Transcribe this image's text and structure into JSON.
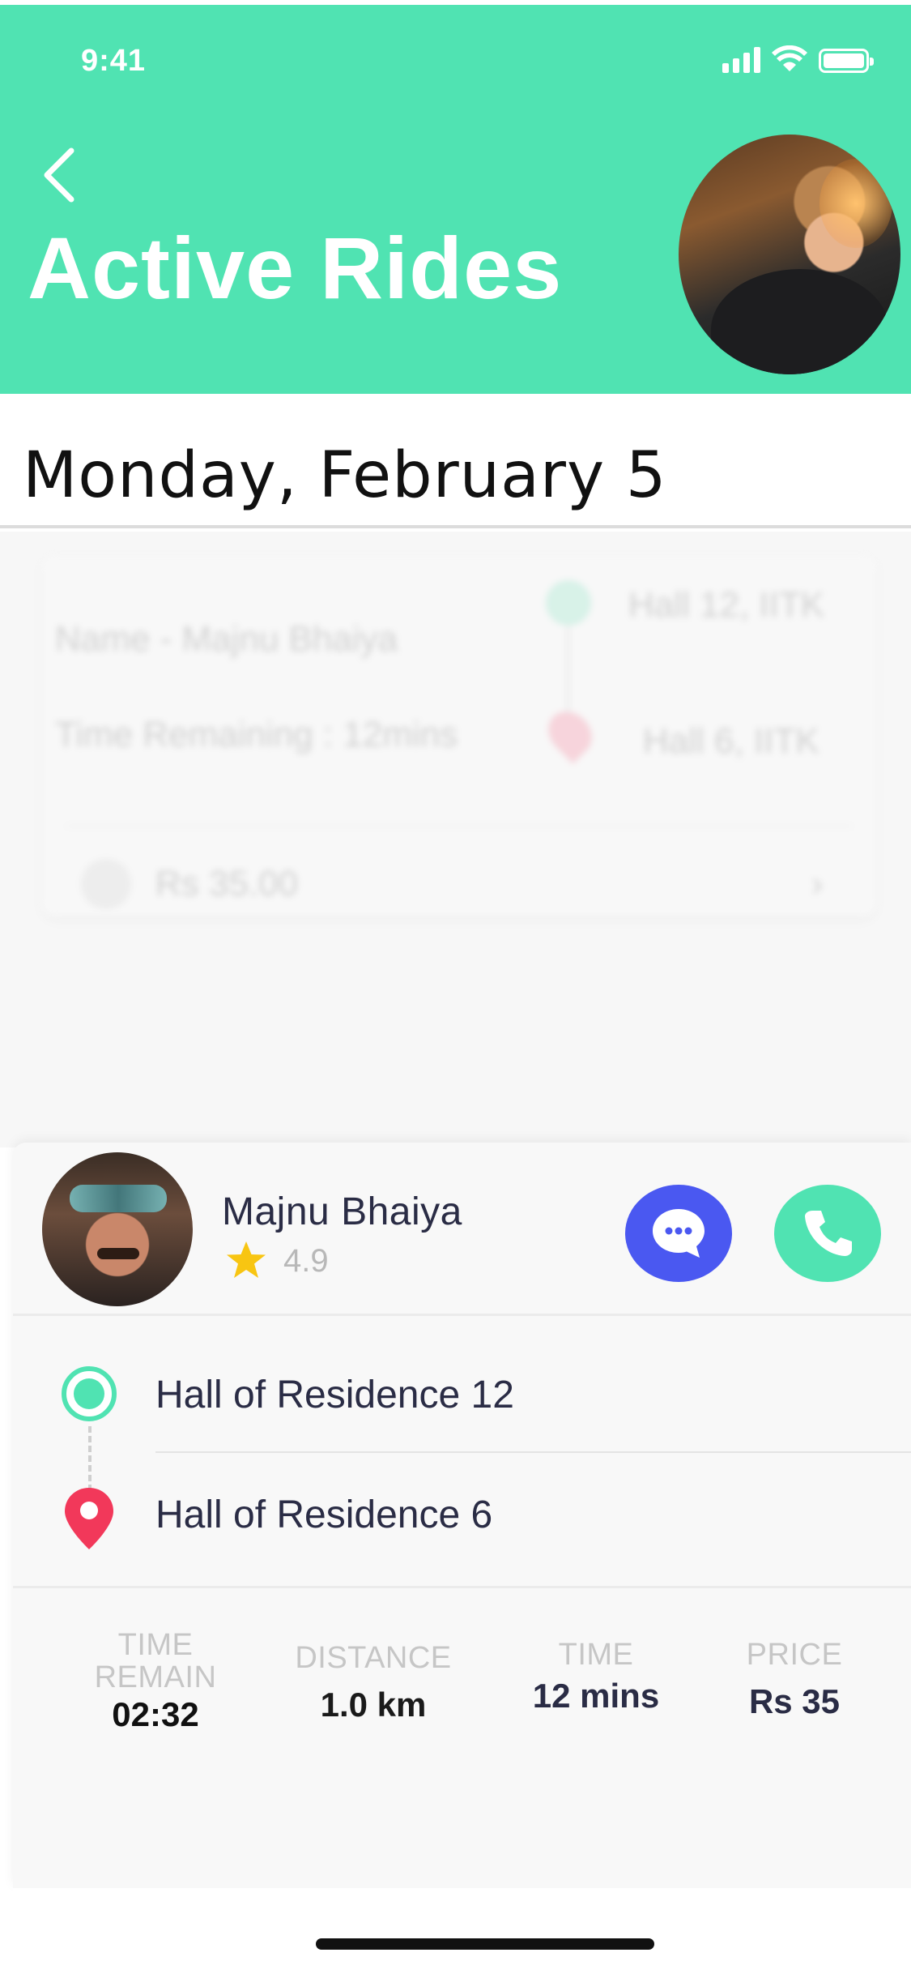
{
  "status_bar": {
    "time": "9:41"
  },
  "header": {
    "title": "Active Rides"
  },
  "date": "Monday, February 5",
  "background_card": {
    "name_line": "Name - Majnu Bhaiya",
    "time_line": "Time Remaining : 12mins",
    "from": "Hall 12, IITK",
    "to": "Hall 6, IITK",
    "price": "Rs 35.00"
  },
  "driver": {
    "name": "Majnu Bhaiya",
    "rating": "4.9"
  },
  "route": {
    "origin": "Hall of Residence 12",
    "destination": "Hall of Residence 6"
  },
  "stats": [
    {
      "label": "TIME REMAIN",
      "value": "02:32"
    },
    {
      "label": "DISTANCE",
      "value": "1.0 km"
    },
    {
      "label": "TIME",
      "value": "12 mins"
    },
    {
      "label": "PRICE",
      "value": "Rs 35"
    }
  ],
  "colors": {
    "accent": "#50e3b2",
    "chat": "#4a58f1",
    "pin": "#f2385a",
    "star": "#f8c512",
    "text_dark": "#2a2c45"
  }
}
